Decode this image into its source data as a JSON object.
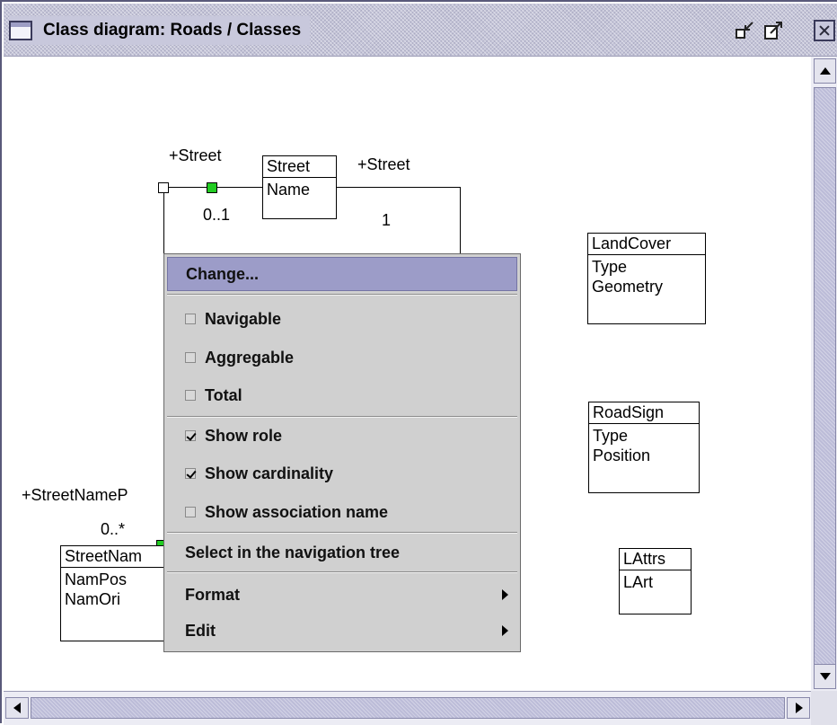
{
  "window": {
    "title": "Class diagram: Roads / Classes"
  },
  "diagram": {
    "classes": [
      {
        "name": "Street",
        "attrs": [
          "Name"
        ]
      },
      {
        "name": "LandCover",
        "attrs": [
          "Type",
          "Geometry"
        ]
      },
      {
        "name": "RoadSign",
        "attrs": [
          "Type",
          "Position"
        ]
      },
      {
        "name": "LAttrs",
        "attrs": [
          "LArt"
        ]
      },
      {
        "name": "StreetNam",
        "attrs": [
          "NamPos",
          "NamOri"
        ]
      }
    ],
    "labels": {
      "role_left": "+Street",
      "role_right": "+Street",
      "card_left": "0..1",
      "card_right": "1",
      "role_bottom": "+StreetNameP",
      "card_bottom": "0..*"
    }
  },
  "menu": {
    "change": "Change...",
    "navigable": "Navigable",
    "aggregable": "Aggregable",
    "total": "Total",
    "show_role": "Show role",
    "show_cardinality": "Show cardinality",
    "show_association_name": "Show association name",
    "select_in_tree": "Select in the navigation tree",
    "format": "Format",
    "edit": "Edit",
    "checked": {
      "navigable": false,
      "aggregable": false,
      "total": false,
      "show_role": true,
      "show_cardinality": true,
      "show_association_name": false
    }
  },
  "colors": {
    "highlight": "#9c9cc8",
    "handle_green": "#22cc22",
    "titlebar": "#c4c4d8"
  }
}
